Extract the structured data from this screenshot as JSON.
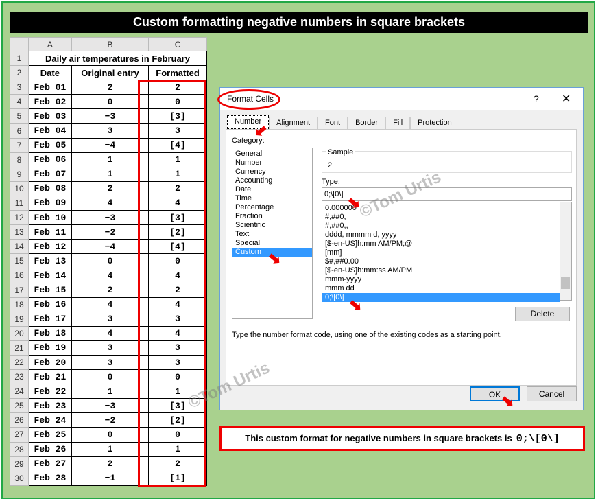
{
  "title": "Custom formatting negative numbers in square brackets",
  "sheet": {
    "columns": [
      "A",
      "B",
      "C"
    ],
    "heading": "Daily air temperatures in February",
    "headers": [
      "Date",
      "Original entry",
      "Formatted"
    ],
    "rows": [
      [
        "Feb 01",
        "2",
        "2"
      ],
      [
        "Feb 02",
        "0",
        "0"
      ],
      [
        "Feb 03",
        "−3",
        "[3]"
      ],
      [
        "Feb 04",
        "3",
        "3"
      ],
      [
        "Feb 05",
        "−4",
        "[4]"
      ],
      [
        "Feb 06",
        "1",
        "1"
      ],
      [
        "Feb 07",
        "1",
        "1"
      ],
      [
        "Feb 08",
        "2",
        "2"
      ],
      [
        "Feb 09",
        "4",
        "4"
      ],
      [
        "Feb 10",
        "−3",
        "[3]"
      ],
      [
        "Feb 11",
        "−2",
        "[2]"
      ],
      [
        "Feb 12",
        "−4",
        "[4]"
      ],
      [
        "Feb 13",
        "0",
        "0"
      ],
      [
        "Feb 14",
        "4",
        "4"
      ],
      [
        "Feb 15",
        "2",
        "2"
      ],
      [
        "Feb 16",
        "4",
        "4"
      ],
      [
        "Feb 17",
        "3",
        "3"
      ],
      [
        "Feb 18",
        "4",
        "4"
      ],
      [
        "Feb 19",
        "3",
        "3"
      ],
      [
        "Feb 20",
        "3",
        "3"
      ],
      [
        "Feb 21",
        "0",
        "0"
      ],
      [
        "Feb 22",
        "1",
        "1"
      ],
      [
        "Feb 23",
        "−3",
        "[3]"
      ],
      [
        "Feb 24",
        "−2",
        "[2]"
      ],
      [
        "Feb 25",
        "0",
        "0"
      ],
      [
        "Feb 26",
        "1",
        "1"
      ],
      [
        "Feb 27",
        "2",
        "2"
      ],
      [
        "Feb 28",
        "−1",
        "[1]"
      ]
    ]
  },
  "dialog": {
    "title": "Format Cells",
    "help": "?",
    "close": "✕",
    "tabs": [
      "Number",
      "Alignment",
      "Font",
      "Border",
      "Fill",
      "Protection"
    ],
    "category_label": "Category:",
    "categories": [
      "General",
      "Number",
      "Currency",
      "Accounting",
      "Date",
      "Time",
      "Percentage",
      "Fraction",
      "Scientific",
      "Text",
      "Special",
      "Custom"
    ],
    "selected_category": "Custom",
    "sample_label": "Sample",
    "sample_value": "2",
    "type_label": "Type:",
    "type_value": "0;\\[0\\]",
    "type_list": [
      "0.000000",
      "#,##0,",
      "#,##0,,",
      "dddd, mmmm d, yyyy",
      "[$-en-US]h:mm AM/PM;@",
      "[mm]",
      "$#,##0.00",
      "[$-en-US]h:mm:ss AM/PM",
      "mmm-yyyy",
      "mmm dd",
      "0;\\[0\\]"
    ],
    "delete": "Delete",
    "hint": "Type the number format code, using one of the existing codes as a starting point.",
    "ok": "OK",
    "cancel": "Cancel"
  },
  "watermark": "©Tom Urtis",
  "note": {
    "text": "This custom format for negative numbers in square brackets is",
    "code": "0;\\[0\\]"
  },
  "colors": {
    "background": "#a9d18e",
    "highlight": "#ee0000",
    "selection": "#3399ff"
  }
}
